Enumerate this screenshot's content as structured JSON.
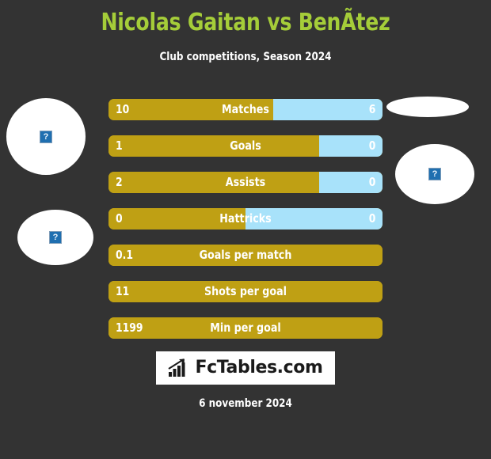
{
  "header": {
    "title": "Nicolas Gaitan vs BenÃ­tez",
    "subtitle": "Club competitions, Season 2024",
    "title_color": "#a5cd39"
  },
  "colors": {
    "background": "#333333",
    "left_bar": "#bfa014",
    "right_bar": "#a8e2fa",
    "text": "#ffffff"
  },
  "players": {
    "left": {
      "name": "Nicolas Gaitan",
      "photo_alt_icon": "broken-image-icon",
      "club_badge_alt_icon": "broken-image-icon"
    },
    "right": {
      "name": "BenÃ­tez",
      "photo_alt_icon": "broken-image-icon",
      "club_badge_alt_icon": "broken-image-icon"
    }
  },
  "chart_data": {
    "type": "bar",
    "title": "Nicolas Gaitan vs BenÃ­tez",
    "subtitle": "Club competitions, Season 2024",
    "orientation": "horizontal-diverging",
    "legend": [
      "Nicolas Gaitan",
      "BenÃ­tez"
    ],
    "series": [
      {
        "name": "Nicolas Gaitan",
        "color": "#bfa014",
        "values": [
          "10",
          "1",
          "2",
          "0",
          "0.1",
          "11",
          "1199"
        ]
      },
      {
        "name": "BenÃ­tez",
        "color": "#a8e2fa",
        "values": [
          "6",
          "0",
          "0",
          "0",
          null,
          null,
          null
        ]
      }
    ],
    "categories": [
      "Matches",
      "Goals",
      "Assists",
      "Hattricks",
      "Goals per match",
      "Shots per goal",
      "Min per goal"
    ],
    "rows": [
      {
        "label": "Matches",
        "left_value": "10",
        "right_value": "6",
        "left_pct": 60.0,
        "has_right": true
      },
      {
        "label": "Goals",
        "left_value": "1",
        "right_value": "0",
        "left_pct": 77.0,
        "has_right": true
      },
      {
        "label": "Assists",
        "left_value": "2",
        "right_value": "0",
        "left_pct": 77.0,
        "has_right": true
      },
      {
        "label": "Hattricks",
        "left_value": "0",
        "right_value": "0",
        "left_pct": 50.0,
        "has_right": true
      },
      {
        "label": "Goals per match",
        "left_value": "0.1",
        "right_value": "",
        "left_pct": 100.0,
        "has_right": false
      },
      {
        "label": "Shots per goal",
        "left_value": "11",
        "right_value": "",
        "left_pct": 100.0,
        "has_right": false
      },
      {
        "label": "Min per goal",
        "left_value": "1199",
        "right_value": "",
        "left_pct": 100.0,
        "has_right": false
      }
    ]
  },
  "footer": {
    "logo_text": "FcTables.com",
    "logo_icon": "bar-chart-growth-icon",
    "date": "6 november 2024"
  }
}
